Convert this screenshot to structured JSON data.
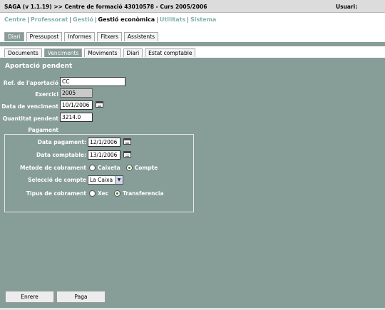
{
  "titlebar": {
    "app_title": "SAGA (v 1.1.19) >> Centre de formació 43010578 - Curs 2005/2006",
    "user_label": "Usuari:"
  },
  "topnav": {
    "items": [
      {
        "label": "Centre",
        "active": false
      },
      {
        "label": "Professorat",
        "active": false
      },
      {
        "label": "Gestió",
        "active": false
      },
      {
        "label": "Gestió econòmica",
        "active": true
      },
      {
        "label": "Utilitats",
        "active": false
      },
      {
        "label": "Sistema",
        "active": false
      }
    ],
    "separator": "|"
  },
  "tabs_primary": [
    {
      "label": "Diari",
      "active": true
    },
    {
      "label": "Pressupost",
      "active": false
    },
    {
      "label": "Informes",
      "active": false
    },
    {
      "label": "Fitxers",
      "active": false
    },
    {
      "label": "Assistents",
      "active": false
    }
  ],
  "tabs_secondary": [
    {
      "label": "Documents",
      "active": false
    },
    {
      "label": "Venciments",
      "active": true
    },
    {
      "label": "Moviments",
      "active": false
    },
    {
      "label": "Diari",
      "active": false
    },
    {
      "label": "Estat comptable",
      "active": false
    }
  ],
  "form": {
    "heading": "Aportació pendent",
    "ref_label": "Ref. de l'aportació",
    "ref_value": "CC",
    "exercici_label": "Exercici",
    "exercici_value": "2005",
    "data_venciment_label": "Data de venciment",
    "data_venciment_value": "10/1/2006",
    "quantitat_label": "Quantitat pendent",
    "quantitat_value": "3214.0",
    "pagament_label": "Pagament",
    "payment": {
      "data_pagament_label": "Data pagament:",
      "data_pagament_value": "12/1/2006",
      "data_comptable_label": "Data comptable:",
      "data_comptable_value": "13/1/2006",
      "metode_label": "Metode de cobrament",
      "metode_options": [
        "Caixeta",
        "Compte"
      ],
      "metode_selected": "Compte",
      "compte_label": "Selecció de compte",
      "compte_value": "La Caixa",
      "tipus_label": "Tipus de cobrament",
      "tipus_options": [
        "Xec",
        "Transferencia"
      ],
      "tipus_selected": "Transferencia"
    }
  },
  "buttons": {
    "back": "Enrere",
    "pay": "Paga"
  },
  "colors": {
    "panel": "#879d98",
    "titlebar": "#dcdcdc",
    "nav_link": "#7fb0ac"
  },
  "icons": [
    "calendar-icon",
    "dropdown-arrow-icon"
  ]
}
